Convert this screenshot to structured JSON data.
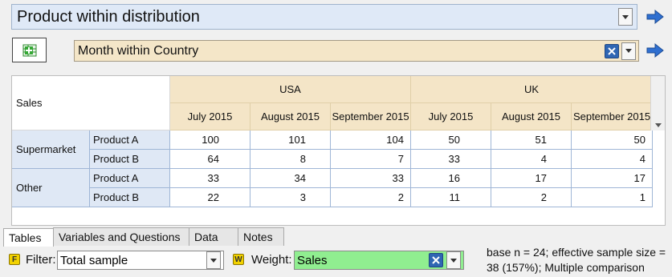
{
  "rows_selector": {
    "value": "Product within distribution"
  },
  "columns_selector": {
    "value": "Month within Country"
  },
  "table": {
    "corner_label": "Sales",
    "countries": [
      "USA",
      "UK"
    ],
    "months": [
      "July 2015",
      "August 2015",
      "September 2015",
      "July 2015",
      "August 2015",
      "September 2015"
    ],
    "groups": [
      "Supermarket",
      "Other"
    ],
    "rows": [
      {
        "label": "Product A",
        "values": [
          "100",
          "101",
          "104",
          "50",
          "51",
          "50"
        ]
      },
      {
        "label": "Product B",
        "values": [
          "64",
          "8",
          "7",
          "33",
          "4",
          "4"
        ]
      },
      {
        "label": "Product A",
        "values": [
          "33",
          "34",
          "33",
          "16",
          "17",
          "17"
        ]
      },
      {
        "label": "Product B",
        "values": [
          "22",
          "3",
          "2",
          "11",
          "2",
          "1"
        ]
      }
    ]
  },
  "tabs": [
    "Tables",
    "Variables and Questions",
    "Data",
    "Notes"
  ],
  "filter": {
    "badge": "F",
    "label": "Filter:",
    "value": "Total sample"
  },
  "weight": {
    "badge": "W",
    "label": "Weight:",
    "value": "Sales"
  },
  "footer_note": "base n = 24; effective sample size = 38 (157%); Multiple comparison",
  "colors": {
    "header_fill": "#f4e5c7",
    "row_label_fill": "#dfe8f5",
    "weight_fill": "#90ee90",
    "accent_blue": "#2f66b3"
  }
}
